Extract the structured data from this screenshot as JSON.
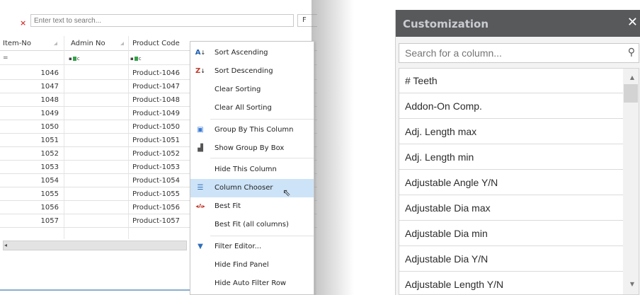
{
  "grid": {
    "find_close": "×",
    "search_placeholder": "Enter text to search...",
    "find_button": "F",
    "columns": [
      "Item-No",
      "Admin No",
      "Product Code"
    ],
    "filter_eq": "=",
    "filter_abc": "c",
    "rows": [
      {
        "item": "1046",
        "product": "Product-1046"
      },
      {
        "item": "1047",
        "product": "Product-1047"
      },
      {
        "item": "1048",
        "product": "Product-1048"
      },
      {
        "item": "1049",
        "product": "Product-1049"
      },
      {
        "item": "1050",
        "product": "Product-1050"
      },
      {
        "item": "1051",
        "product": "Product-1051"
      },
      {
        "item": "1052",
        "product": "Product-1052"
      },
      {
        "item": "1053",
        "product": "Product-1053"
      },
      {
        "item": "1054",
        "product": "Product-1054"
      },
      {
        "item": "1055",
        "product": "Product-1055"
      },
      {
        "item": "1056",
        "product": "Product-1056"
      },
      {
        "item": "1057",
        "product": "Product-1057"
      }
    ]
  },
  "context_menu": {
    "items": [
      {
        "label": "Sort Ascending",
        "icon": "sort-ascending-icon"
      },
      {
        "label": "Sort Descending",
        "icon": "sort-descending-icon"
      },
      {
        "label": "Clear Sorting"
      },
      {
        "label": "Clear All Sorting"
      },
      {
        "label": "Group By This Column",
        "icon": "group-by-icon"
      },
      {
        "label": "Show Group By Box",
        "icon": "group-box-icon"
      },
      {
        "label": "Hide This Column"
      },
      {
        "label": "Column Chooser",
        "icon": "column-chooser-icon",
        "highlighted": true
      },
      {
        "label": "Best Fit",
        "icon": "best-fit-icon"
      },
      {
        "label": "Best Fit (all columns)"
      },
      {
        "label": "Filter Editor...",
        "icon": "filter-icon"
      },
      {
        "label": "Hide Find Panel"
      },
      {
        "label": "Hide Auto Filter Row"
      }
    ],
    "highlight_color": "#cde3f7"
  },
  "customization": {
    "title": "Customization",
    "close": "✕",
    "search_placeholder": "Search for a column...",
    "columns": [
      "# Teeth",
      "Addon-On Comp.",
      "Adj. Length max",
      "Adj. Length min",
      "Adjustable Angle Y/N",
      "Adjustable Dia max",
      "Adjustable Dia min",
      "Adjustable Dia Y/N",
      "Adjustable Length Y/N"
    ],
    "header_color": "#58595b"
  }
}
